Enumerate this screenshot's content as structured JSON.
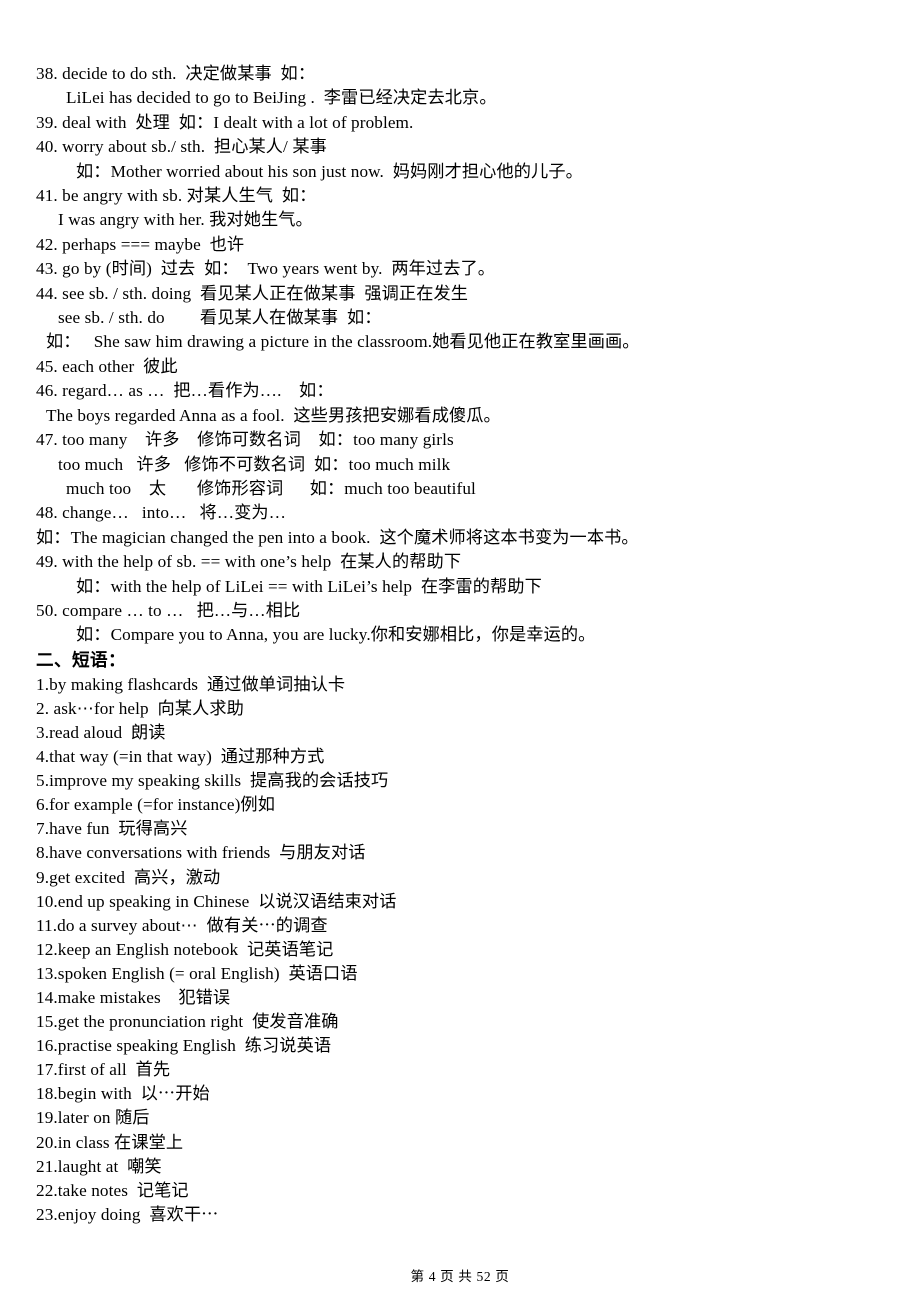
{
  "document": {
    "grammar_section": {
      "lines": [
        {
          "indent": 0,
          "text": "38. decide to do sth.  决定做某事  如："
        },
        {
          "indent": 3,
          "text": "LiLei has decided to go to BeiJing .  李雷已经决定去北京。"
        },
        {
          "indent": 0,
          "text": "39. deal with  处理  如：I dealt with a lot of problem."
        },
        {
          "indent": 0,
          "text": "40. worry about sb./ sth.  担心某人/ 某事"
        },
        {
          "indent": 4,
          "text": "如：Mother worried about his son just now.  妈妈刚才担心他的儿子。"
        },
        {
          "indent": 0,
          "text": "41. be angry with sb. 对某人生气  如："
        },
        {
          "indent": 2,
          "text": "I was angry with her. 我对她生气。"
        },
        {
          "indent": 0,
          "text": "42. perhaps === maybe  也许"
        },
        {
          "indent": 0,
          "text": "43. go by (时间)  过去  如：  Two years went by.  两年过去了。"
        },
        {
          "indent": 0,
          "text": "44. see sb. / sth. doing  看见某人正在做某事  强调正在发生"
        },
        {
          "indent": 2,
          "text": "see sb. / sth. do        看见某人在做某事  如："
        },
        {
          "indent": 1,
          "text": "如：   She saw him drawing a picture in the classroom.她看见他正在教室里画画。"
        },
        {
          "indent": 0,
          "text": "45. each other  彼此"
        },
        {
          "indent": 0,
          "text": "46. regard… as …  把…看作为….    如："
        },
        {
          "indent": 1,
          "text": "The boys regarded Anna as a fool.  这些男孩把安娜看成傻瓜。"
        },
        {
          "indent": 0,
          "text": "47. too many    许多    修饰可数名词    如：too many girls"
        },
        {
          "indent": 2,
          "text": "too much   许多   修饰不可数名词  如：too much milk"
        },
        {
          "indent": 3,
          "text": "much too    太       修饰形容词      如：much too beautiful"
        },
        {
          "indent": 0,
          "text": "48. change…   into…   将…变为…"
        },
        {
          "indent": 0,
          "text": "如：The magician changed the pen into a book.  这个魔术师将这本书变为一本书。"
        },
        {
          "indent": 0,
          "text": "49. with the help of sb. == with one’s help  在某人的帮助下"
        },
        {
          "indent": 4,
          "text": "如：with the help of LiLei == with LiLei’s help  在李雷的帮助下"
        },
        {
          "indent": 0,
          "text": "50. compare … to …   把…与…相比"
        },
        {
          "indent": 4,
          "text": "如：Compare you to Anna, you are lucky.你和安娜相比，你是幸运的。"
        }
      ]
    },
    "phrase_section": {
      "heading": "二、短语：",
      "items": [
        "1.by making flashcards  通过做单词抽认卡",
        "2. ask⋯for help  向某人求助",
        "3.read aloud  朗读",
        "4.that way (=in that way)  通过那种方式",
        "5.improve my speaking skills  提高我的会话技巧",
        "6.for example (=for instance)例如",
        "7.have fun  玩得高兴",
        "8.have conversations with friends  与朋友对话",
        "9.get excited  高兴，激动",
        "10.end up speaking in Chinese  以说汉语结束对话",
        "11.do a survey about⋯  做有关⋯的调查",
        "12.keep an English notebook  记英语笔记",
        "13.spoken English (= oral English)  英语口语",
        "14.make mistakes    犯错误",
        "15.get the pronunciation right  使发音准确",
        "16.practise speaking English  练习说英语",
        "17.first of all  首先",
        "18.begin with  以⋯开始",
        "19.later on 随后",
        "20.in class 在课堂上",
        "21.laught at  嘲笑",
        "22.take notes  记笔记",
        "23.enjoy doing  喜欢干⋯"
      ]
    },
    "footer": {
      "page_label": "第 4 页 共 52 页"
    }
  }
}
